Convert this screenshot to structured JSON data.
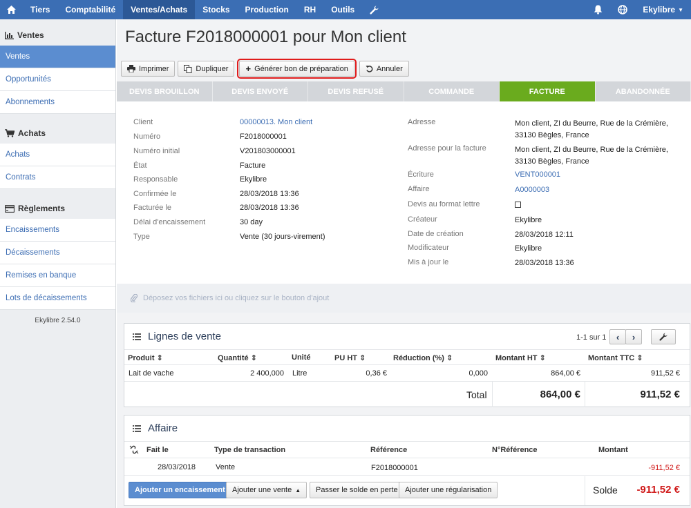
{
  "topbar": {
    "home_icon": "home-icon",
    "items": [
      "Tiers",
      "Comptabilité",
      "Ventes/Achats",
      "Stocks",
      "Production",
      "RH",
      "Outils"
    ],
    "user": "Ekylibre"
  },
  "sidebar": {
    "sections": [
      {
        "title": "Ventes",
        "items": [
          "Ventes",
          "Opportunités",
          "Abonnements"
        ]
      },
      {
        "title": "Achats",
        "items": [
          "Achats",
          "Contrats"
        ]
      },
      {
        "title": "Règlements",
        "items": [
          "Encaissements",
          "Décaissements",
          "Remises en banque",
          "Lots de décaissements"
        ]
      }
    ],
    "version": "Ekylibre 2.54.0"
  },
  "page": {
    "title": "Facture F2018000001 pour Mon client"
  },
  "toolbar": {
    "print": "Imprimer",
    "duplicate": "Dupliquer",
    "generate": "Générer bon de préparation",
    "cancel": "Annuler"
  },
  "steps": [
    "DEVIS BROUILLON",
    "DEVIS ENVOYÉ",
    "DEVIS REFUSÉ",
    "COMMANDE",
    "FACTURE",
    "ABANDONNÉE"
  ],
  "info": {
    "left": [
      {
        "label": "Client",
        "value": "00000013. Mon client",
        "link": true
      },
      {
        "label": "Numéro",
        "value": "F2018000001"
      },
      {
        "label": "Numéro initial",
        "value": "V201803000001"
      },
      {
        "label": "État",
        "value": "Facture"
      },
      {
        "label": "Responsable",
        "value": "Ekylibre"
      },
      {
        "label": "Confirmée le",
        "value": "28/03/2018 13:36"
      },
      {
        "label": "Facturée le",
        "value": "28/03/2018 13:36"
      },
      {
        "label": "Délai d'encaissement",
        "value": "30 day"
      },
      {
        "label": "Type",
        "value": "Vente (30 jours-virement)"
      }
    ],
    "right": {
      "address_label": "Adresse",
      "address_line1": "Mon client, ZI du Beurre, Rue de la Crémière,",
      "address_line2": "33130 Bègles, France",
      "invoice_address_label": "Adresse pour la facture",
      "invoice_address_line1": "Mon client, ZI du Beurre, Rue de la Crémière,",
      "invoice_address_line2": "33130 Bègles, France",
      "entry_label": "Écriture",
      "entry_value": "VENT000001",
      "affair_label": "Affaire",
      "affair_value": "A0000003",
      "letter_label": "Devis au format lettre",
      "creator_label": "Créateur",
      "creator_value": "Ekylibre",
      "created_label": "Date de création",
      "created_value": "28/03/2018 12:11",
      "modifier_label": "Modificateur",
      "modifier_value": "Ekylibre",
      "updated_label": "Mis à jour le",
      "updated_value": "28/03/2018 13:36"
    }
  },
  "dropzone": "Déposez vos fichiers ici ou cliquez sur le bouton d'ajout",
  "sales_lines": {
    "title": "Lignes de vente",
    "pagination": "1-1 sur 1",
    "columns": [
      "Produit",
      "Quantité",
      "Unité",
      "PU HT",
      "Réduction (%)",
      "Montant HT",
      "Montant TTC"
    ],
    "rows": [
      {
        "product": "Lait de vache",
        "quantity": "2 400,000",
        "unit": "Litre",
        "unit_price": "0,36 €",
        "reduction": "0,000",
        "amount_ht": "864,00 €",
        "amount_ttc": "911,52 €"
      }
    ],
    "total_label": "Total",
    "total_ht": "864,00 €",
    "total_ttc": "911,52 €"
  },
  "affair": {
    "title": "Affaire",
    "columns": [
      "Fait le",
      "Type de transaction",
      "Référence",
      "N°Référence",
      "Montant"
    ],
    "rows": [
      {
        "date": "28/03/2018",
        "type": "Vente",
        "reference": "F2018000001",
        "number": "",
        "amount": "-911,52 €"
      }
    ],
    "buttons": {
      "add_payment": "Ajouter un encaissement",
      "add_sale": "Ajouter une vente",
      "write_off": "Passer le solde en perte",
      "add_regularization": "Ajouter une régularisation"
    },
    "balance_label": "Solde",
    "balance_value": "-911,52 €"
  },
  "colors": {
    "topbar": "#3b6eb4",
    "active_step": "#6aab1e",
    "link": "#3c6db3",
    "negative": "#d01919"
  }
}
